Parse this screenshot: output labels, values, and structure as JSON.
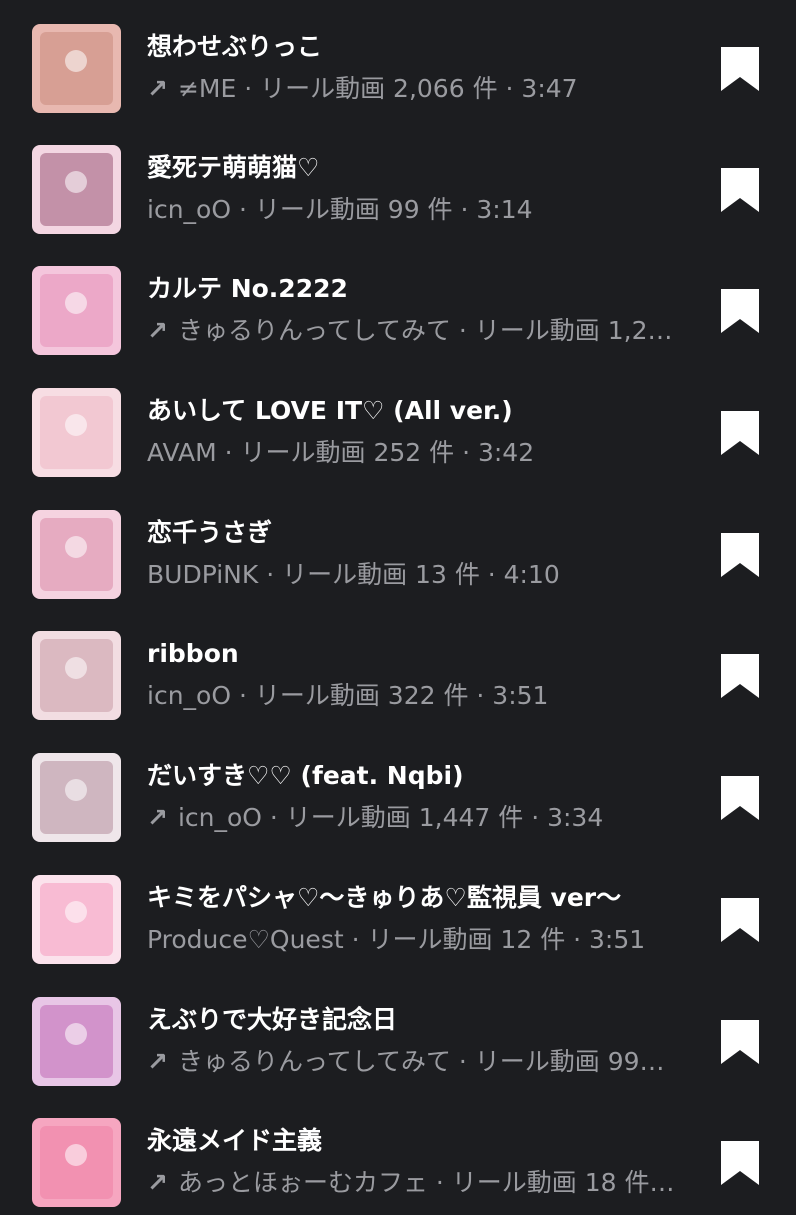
{
  "items": [
    {
      "title": "想わせぶりっこ",
      "has_arrow": true,
      "meta": "≠ME · リール動画 2,066 件 · 3:47",
      "thumb_color": "#e8b8b0",
      "thumb_accent": "#c88a7e"
    },
    {
      "title": "愛死テ萌萌猫♡",
      "has_arrow": false,
      "meta": "icn_oO · リール動画 99 件 · 3:14",
      "thumb_color": "#f3d6e2",
      "thumb_accent": "#9a5a78"
    },
    {
      "title": "カルテ No.2222",
      "has_arrow": true,
      "meta": "きゅるりんってしてみて · リール動画 1,2…",
      "thumb_color": "#f4c6dc",
      "thumb_accent": "#e58fb8"
    },
    {
      "title": "あいして LOVE IT♡ (All ver.)",
      "has_arrow": false,
      "meta": "AVAM · リール動画 252 件 · 3:42",
      "thumb_color": "#f7dde3",
      "thumb_accent": "#efb6c4"
    },
    {
      "title": "恋千うさぎ",
      "has_arrow": false,
      "meta": "BUDPiNK · リール動画 13 件 · 4:10",
      "thumb_color": "#f5d3e0",
      "thumb_accent": "#d98aa8"
    },
    {
      "title": "ribbon",
      "has_arrow": false,
      "meta": "icn_oO · リール動画 322 件 · 3:51",
      "thumb_color": "#f2dde2",
      "thumb_accent": "#c99aa5"
    },
    {
      "title": "だいすき♡♡ (feat. Nqbi)",
      "has_arrow": true,
      "meta": "icn_oO · リール動画 1,447 件 · 3:34",
      "thumb_color": "#efe6ea",
      "thumb_accent": "#b58e9c"
    },
    {
      "title": "キミをパシャ♡〜きゅりあ♡監視員 ver〜",
      "has_arrow": false,
      "meta": "Produce♡Quest · リール動画 12 件 · 3:51",
      "thumb_color": "#fbe2ec",
      "thumb_accent": "#f59ac0"
    },
    {
      "title": "えぶりで大好き記念日",
      "has_arrow": true,
      "meta": "きゅるりんってしてみて · リール動画 99…",
      "thumb_color": "#e8c6e6",
      "thumb_accent": "#c06ab4"
    },
    {
      "title": "永遠メイド主義",
      "has_arrow": true,
      "meta": "あっとほぉーむカフェ · リール動画 18 件…",
      "thumb_color": "#f6a6c0",
      "thumb_accent": "#ef7fa4"
    }
  ],
  "arrow_glyph": "↗",
  "colors": {
    "background": "#1c1d20",
    "title": "#ffffff",
    "meta": "#9a9ba0",
    "bookmark": "#ffffff"
  }
}
